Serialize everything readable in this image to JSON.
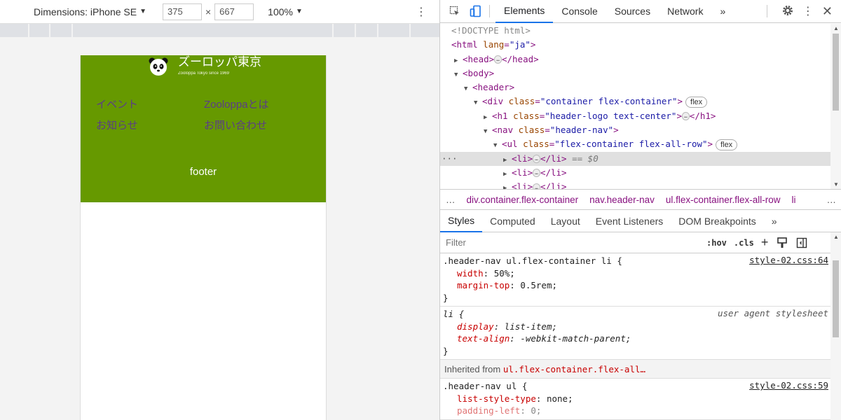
{
  "device_toolbar": {
    "dimensions_label": "Dimensions: iPhone SE",
    "width": "375",
    "height": "667",
    "times": "×",
    "zoom": "100%"
  },
  "site": {
    "logo_jp": "ズーロッパ東京",
    "logo_en": "Zooloppa Tokyo since 1969",
    "nav": [
      "イベント",
      "Zooloppaとは",
      "お知らせ",
      "お問い合わせ"
    ],
    "footer": "footer"
  },
  "devtools": {
    "tabs": [
      "Elements",
      "Console",
      "Sources",
      "Network"
    ],
    "more": "»",
    "dom": {
      "doctype": "<!DOCTYPE html>",
      "html_open": "<html",
      "lang_attr": "lang",
      "lang_val": "\"ja\"",
      "head": "<head>",
      "head_close": "</head>",
      "body": "<body>",
      "header": "<header>",
      "div_open": "<div",
      "class_attr": "class",
      "div_class": "\"container flex-container\"",
      "flex_badge": "flex",
      "h1_open": "<h1",
      "h1_class": "\"header-logo text-center\"",
      "h1_close": "</h1>",
      "nav_open": "<nav",
      "nav_class": "\"header-nav\"",
      "ul_open": "<ul",
      "ul_class": "\"flex-container flex-all-row\"",
      "li_open": "<li>",
      "li_close": "</li>",
      "eq0": "== $0",
      "ellipsis": "…"
    },
    "breadcrumbs": [
      "div.container.flex-container",
      "nav.header-nav",
      "ul.flex-container.flex-all-row",
      "li"
    ],
    "style_tabs": [
      "Styles",
      "Computed",
      "Layout",
      "Event Listeners",
      "DOM Breakpoints"
    ],
    "filter_placeholder": "Filter",
    "hov": ":hov",
    "cls": ".cls",
    "plus": "+",
    "rules": {
      "r1_selector": ".header-nav ul.flex-container li {",
      "r1_source": "style-02.css:64",
      "r1_p1": "width",
      "r1_v1": "50%;",
      "r1_p2": "margin-top",
      "r1_v2": "0.5rem;",
      "close": "}",
      "r2_selector": "li {",
      "r2_source": "user agent stylesheet",
      "r2_p1": "display",
      "r2_v1": "list-item;",
      "r2_p2": "text-align",
      "r2_v2": "-webkit-match-parent;",
      "inherited_label": "Inherited from",
      "inherited_from": "ul.flex-container.flex-all…",
      "r3_selector": ".header-nav ul {",
      "r3_source": "style-02.css:59",
      "r3_p1": "list-style-type",
      "r3_v1": "none;",
      "r3_p2": "padding-left",
      "r3_v2": "0;"
    }
  },
  "colors": {
    "header_bg": "#669900",
    "nav_text": "#5b3c88",
    "accent": "#1a73e8"
  }
}
